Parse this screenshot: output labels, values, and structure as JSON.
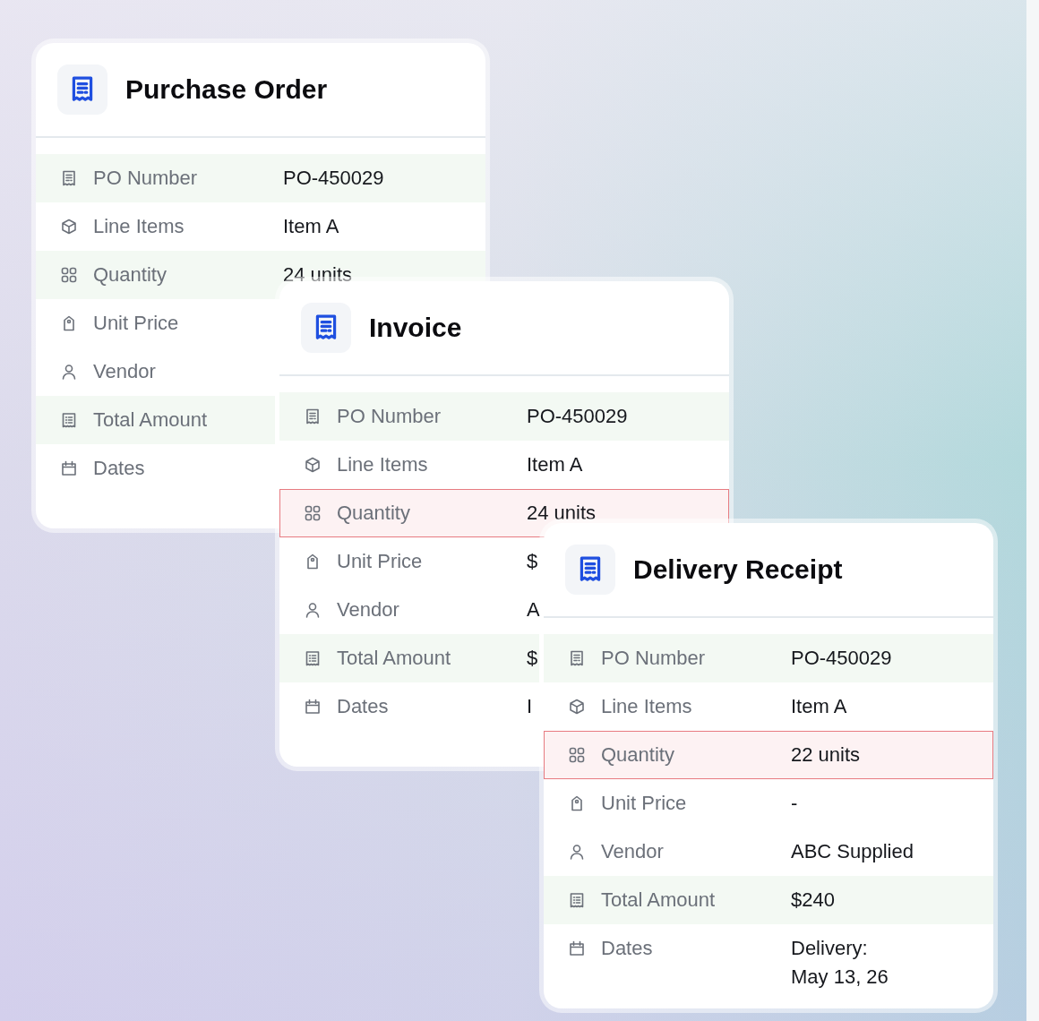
{
  "cards": [
    {
      "title": "Purchase Order",
      "rows": [
        {
          "label": "PO Number",
          "value": "PO-450029",
          "shaded": true,
          "flagged": false
        },
        {
          "label": "Line Items",
          "value": "Item A",
          "shaded": false,
          "flagged": false
        },
        {
          "label": "Quantity",
          "value": "24 units",
          "shaded": true,
          "flagged": false
        },
        {
          "label": "Unit Price",
          "shaded": false,
          "flagged": false
        },
        {
          "label": "Vendor",
          "shaded": false,
          "flagged": false
        },
        {
          "label": "Total Amount",
          "shaded": true,
          "flagged": false
        },
        {
          "label": "Dates",
          "shaded": false,
          "flagged": false
        }
      ]
    },
    {
      "title": "Invoice",
      "rows": [
        {
          "label": "PO Number",
          "value": "PO-450029",
          "shaded": true,
          "flagged": false
        },
        {
          "label": "Line Items",
          "value": "Item A",
          "shaded": false,
          "flagged": false
        },
        {
          "label": "Quantity",
          "value": "24 units",
          "shaded": false,
          "flagged": true
        },
        {
          "label": "Unit Price",
          "value": "$",
          "shaded": false,
          "flagged": false
        },
        {
          "label": "Vendor",
          "value": "A",
          "shaded": false,
          "flagged": false
        },
        {
          "label": "Total Amount",
          "value": "$",
          "shaded": true,
          "flagged": false
        },
        {
          "label": "Dates",
          "value": "I",
          "shaded": false,
          "flagged": false
        }
      ]
    },
    {
      "title": "Delivery Receipt",
      "rows": [
        {
          "label": "PO Number",
          "value": "PO-450029",
          "shaded": true,
          "flagged": false
        },
        {
          "label": "Line Items",
          "value": "Item A",
          "shaded": false,
          "flagged": false
        },
        {
          "label": "Quantity",
          "value": "22 units",
          "shaded": false,
          "flagged": true
        },
        {
          "label": "Unit Price",
          "value": "-",
          "shaded": false,
          "flagged": false
        },
        {
          "label": "Vendor",
          "value": "ABC Supplied",
          "shaded": false,
          "flagged": false
        },
        {
          "label": "Total Amount",
          "value": "$240",
          "shaded": true,
          "flagged": false
        },
        {
          "label": "Dates",
          "value": "Delivery:\nMay 13, 26",
          "shaded": false,
          "flagged": false
        }
      ]
    }
  ]
}
